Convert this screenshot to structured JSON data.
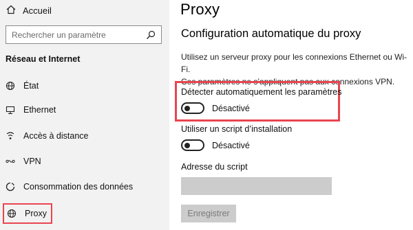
{
  "sidebar": {
    "home_label": "Accueil",
    "search_placeholder": "Rechercher un paramètre",
    "section_title": "Réseau et Internet",
    "items": [
      {
        "label": "État",
        "icon": "globe-status-icon"
      },
      {
        "label": "Ethernet",
        "icon": "ethernet-icon"
      },
      {
        "label": "Accès à distance",
        "icon": "dialup-icon"
      },
      {
        "label": "VPN",
        "icon": "vpn-icon"
      },
      {
        "label": "Consommation des données",
        "icon": "data-usage-icon"
      },
      {
        "label": "Proxy",
        "icon": "globe-icon",
        "selected": true
      }
    ]
  },
  "main": {
    "title": "Proxy",
    "section_heading": "Configuration automatique du proxy",
    "description_line1": "Utilisez un serveur proxy pour les connexions Ethernet ou Wi-Fi.",
    "description_line2": "Ces paramètres ne s’appliquent pas aux connexions VPN.",
    "auto_detect": {
      "label": "Détecter automatiquement les paramètres",
      "state": "Désactivé",
      "on": false
    },
    "setup_script": {
      "label": "Utiliser un script d’installation",
      "state": "Désactivé",
      "on": false
    },
    "script_address": {
      "label": "Adresse du script",
      "value": ""
    },
    "save_label": "Enregistrer"
  },
  "colors": {
    "highlight": "#e9454f",
    "sidebar_bg": "#f2f2f2",
    "disabled_bg": "#cccccc"
  }
}
